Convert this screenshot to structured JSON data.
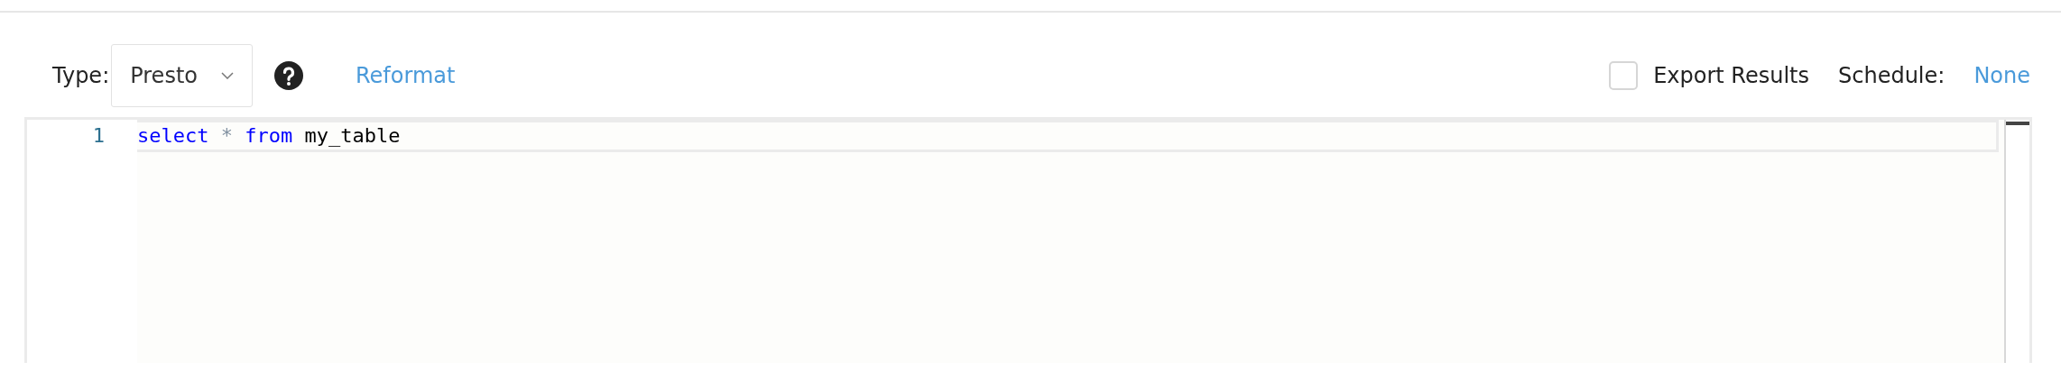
{
  "toolbar": {
    "type_label": "Type:",
    "type_select": {
      "value": "Presto"
    },
    "reformat_link": "Reformat",
    "export_results": {
      "label": "Export Results",
      "checked": false
    },
    "schedule_label": "Schedule:",
    "schedule_link": "None"
  },
  "editor": {
    "lines": [
      {
        "number": "1",
        "active": true,
        "tokens": [
          {
            "kind": "keyword",
            "text": "select"
          },
          {
            "kind": "operator",
            "text": "*"
          },
          {
            "kind": "keyword",
            "text": "from"
          },
          {
            "kind": "identifier",
            "text": "my_table"
          }
        ]
      }
    ]
  }
}
